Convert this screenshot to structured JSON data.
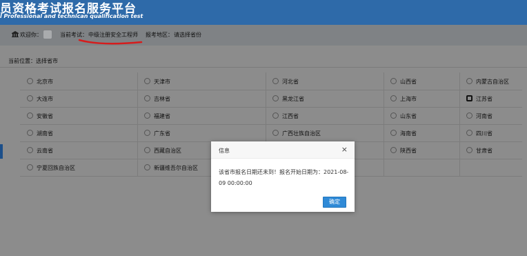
{
  "header": {
    "title": "员资格考试报名服务平台",
    "subtitle": "l Professional and technican qualification test"
  },
  "infobar": {
    "welcome": "欢迎你：",
    "current_exam_label": "当前考试：",
    "current_exam_value": "中级注册安全工程师",
    "region_label": "报考地区：",
    "region_value": "请选择省份",
    "accent_color": "#d61c1c"
  },
  "breadcrumb": "当前位置：选择省市",
  "provinces": [
    [
      "北京市",
      "天津市",
      "河北省",
      "山西省",
      "内蒙古自治区"
    ],
    [
      "大连市",
      "吉林省",
      "黑龙江省",
      "上海市",
      "江苏省"
    ],
    [
      "安徽省",
      "福建省",
      "江西省",
      "山东省",
      "河南省"
    ],
    [
      "湖南省",
      "广东省",
      "广西壮族自治区",
      "海南省",
      "四川省"
    ],
    [
      "云南省",
      "西藏自治区",
      "",
      "陕西省",
      "甘肃省"
    ],
    [
      "宁夏回族自治区",
      "新疆维吾尔自治区",
      "",
      "",
      ""
    ]
  ],
  "selected_province": "江苏省",
  "dialog": {
    "title": "信息",
    "close": "×",
    "message": "该省市报名日期还未到！报名开始日期为：2021-08-09 00:00:00",
    "ok_label": "确定",
    "button_color": "#2f8ad7"
  }
}
